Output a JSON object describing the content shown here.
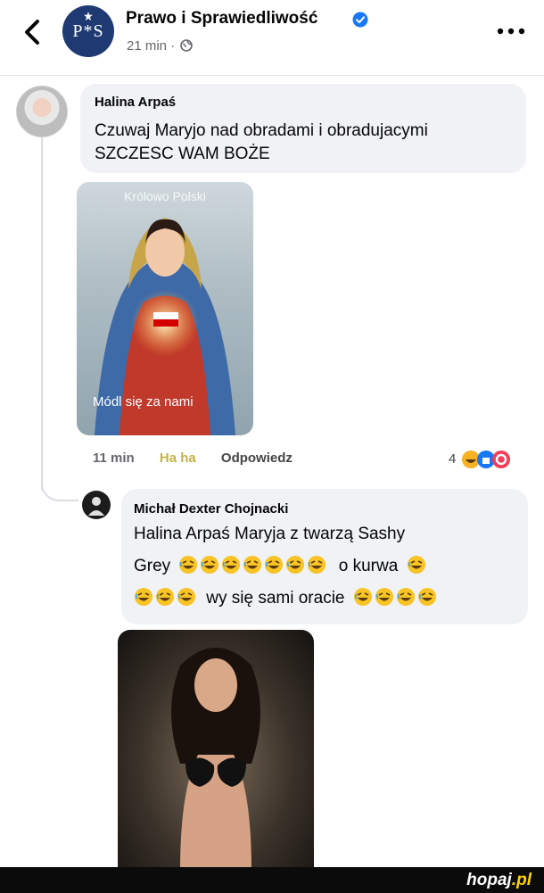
{
  "header": {
    "page_name": "Prawo i Sprawiedliwość",
    "logo_text": "P*S",
    "time": "21 min",
    "separator": "·"
  },
  "comment1": {
    "author": "Halina Arpaś",
    "text_line1": "Czuwaj Maryjo nad obradami i obradujacymi",
    "text_line2": "SZCZESC WAM BOŻE",
    "image_caption_top": "Królowo Polski",
    "image_caption_bottom": "Módl się za nami",
    "actions": {
      "time": "11 min",
      "reaction": "Ha ha",
      "reply": "Odpowiedz"
    },
    "reaction_count": "4"
  },
  "reply": {
    "author": "Michał Dexter Chojnacki",
    "line1": "Halina Arpaś Maryja z twarzą Sashy",
    "line2_text": "Grey",
    "line2_after": "o kurwa",
    "line3_text": "wy się sami oracie"
  },
  "footer": {
    "brand_main": "hopaj",
    "brand_tld": ".pl"
  },
  "colors": {
    "accent": "#1877f2",
    "haha": "#c6b244",
    "bubble": "#f0f2f5",
    "logo_bg": "#1f3a73"
  }
}
